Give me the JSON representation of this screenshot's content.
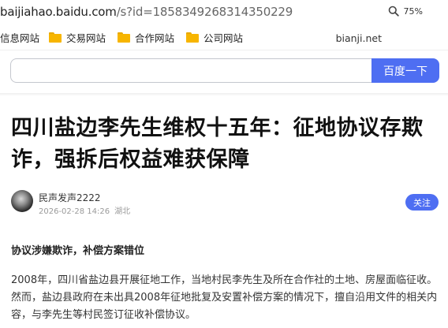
{
  "browser": {
    "url_domain": "baijiahao.baidu.com",
    "url_path": "/s?id=1858349268314350229",
    "zoom": "75%"
  },
  "bookmarks": [
    {
      "label": "信息网站",
      "has_folder_icon": false
    },
    {
      "label": "交易网站",
      "has_folder_icon": true
    },
    {
      "label": "合作网站",
      "has_folder_icon": true
    },
    {
      "label": "公司网站",
      "has_folder_icon": true
    }
  ],
  "bianji": "bianji.net",
  "search": {
    "value": "",
    "button_label": "百度一下"
  },
  "article": {
    "title": "四川盐边李先生维权十五年：征地协议存欺诈，强拆后权益难获保障",
    "author": {
      "name": "民声发声2222",
      "datetime": "2026-02-28 14:26",
      "location": "湖北",
      "follow_label": "关注"
    },
    "subheading": "协议涉嫌欺诈，补偿方案错位",
    "paragraph": "2008年，四川省盐边县开展征地工作，当地村民李先生及所在合作社的土地、房屋面临征收。然而，盐边县政府在未出具2008年征地批复及安置补偿方案的情况下，擅自沿用文件的相关内容，与李先生等村民签订征收补偿协议。"
  },
  "colors": {
    "accent": "#4e6ef2",
    "folder": "#f7b500"
  }
}
